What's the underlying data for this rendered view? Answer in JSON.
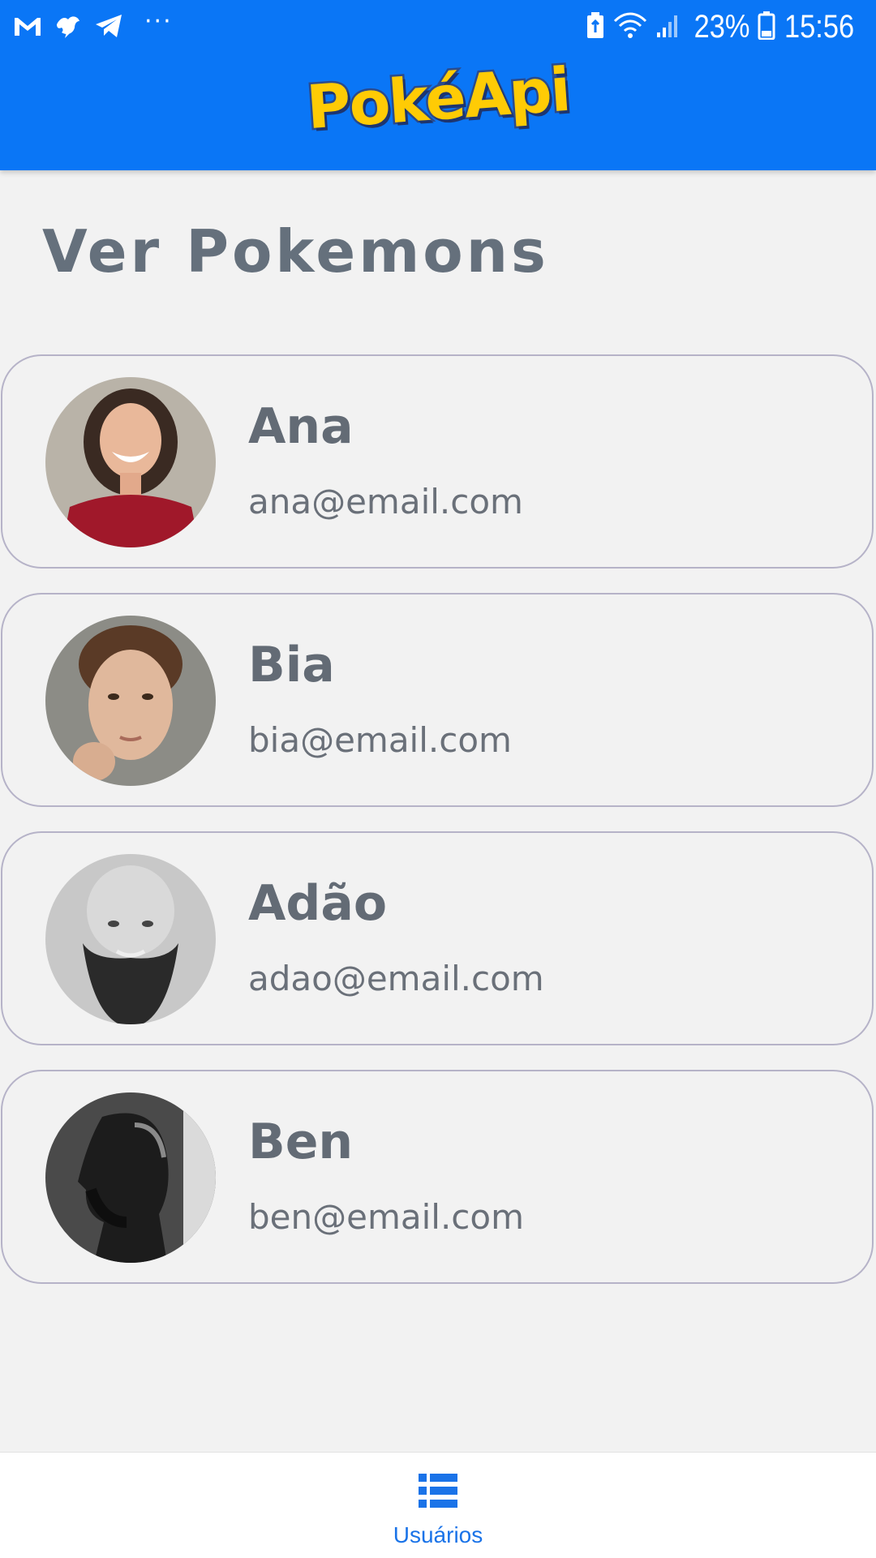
{
  "status_bar": {
    "left_icons": [
      "gmail-icon",
      "notification-bird-icon",
      "telegram-icon"
    ],
    "overflow": "···",
    "battery_percent": "23%",
    "time": "15:56"
  },
  "header": {
    "logo_text": "PokéApi",
    "background": "#0a76f6",
    "logo_color": "#ffcb05"
  },
  "page": {
    "title": "Ver Pokemons"
  },
  "users": [
    {
      "name": "Ana",
      "email": "ana@email.com",
      "avatar": "avatar-photo"
    },
    {
      "name": "Bia",
      "email": "bia@email.com",
      "avatar": "avatar-photo"
    },
    {
      "name": "Adão",
      "email": "adao@email.com",
      "avatar": "avatar-photo"
    },
    {
      "name": "Ben",
      "email": "ben@email.com",
      "avatar": "avatar-photo"
    }
  ],
  "bottom_nav": {
    "items": [
      {
        "label": "Usuários",
        "icon": "list-icon",
        "active": true
      }
    ],
    "active_color": "#1a73e8"
  }
}
